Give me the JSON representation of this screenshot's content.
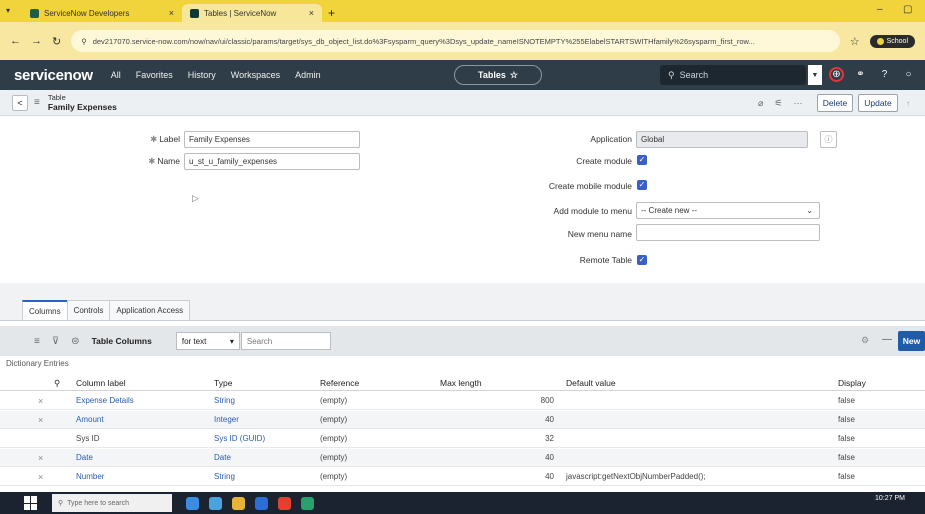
{
  "browser": {
    "tabs": [
      {
        "title": "ServiceNow Developers",
        "active": false
      },
      {
        "title": "Tables | ServiceNow",
        "active": true
      }
    ],
    "url": "dev217070.service-now.com/now/nav/ui/classic/params/target/sys_db_object_list.do%3Fsysparm_query%3Dsys_update_nameISNOTEMPTY%255ElabelSTARTSWITHfamily%26sysparm_first_row...",
    "profile_label": "School"
  },
  "header": {
    "logo": "servicenow",
    "nav": [
      "All",
      "Favorites",
      "History",
      "Workspaces",
      "Admin"
    ],
    "context_pill": "Tables",
    "search_placeholder": "Search"
  },
  "form_header": {
    "record_type": "Table",
    "record_name": "Family Expenses",
    "delete_label": "Delete",
    "update_label": "Update"
  },
  "form": {
    "label_label": "Label",
    "label_value": "Family Expenses",
    "name_label": "Name",
    "name_value": "u_st_u_family_expenses",
    "application_label": "Application",
    "application_value": "Global",
    "create_module_label": "Create module",
    "create_mobile_module_label": "Create mobile module",
    "add_module_label": "Add module to menu",
    "add_module_value": "-- Create new --",
    "new_menu_name_label": "New menu name",
    "new_menu_name_value": "",
    "remote_table_label": "Remote Table",
    "create_module_checked": true,
    "create_mobile_module_checked": true,
    "remote_table_checked": true
  },
  "related_tabs": [
    "Columns",
    "Controls",
    "Application Access"
  ],
  "list": {
    "title": "Table Columns",
    "search_field": "for text",
    "search_placeholder": "Search",
    "new_label": "New",
    "breadcrumb": "Dictionary Entries",
    "columns": [
      "Column label",
      "Type",
      "Reference",
      "Max length",
      "Default value",
      "Display"
    ],
    "rows": [
      {
        "deletable": true,
        "label": "Expense Details",
        "type": "String",
        "reference": "(empty)",
        "max_length": "800",
        "default": "",
        "display": "false"
      },
      {
        "deletable": true,
        "label": "Amount",
        "type": "Integer",
        "reference": "(empty)",
        "max_length": "40",
        "default": "",
        "display": "false"
      },
      {
        "deletable": false,
        "label": "Sys ID",
        "type": "Sys ID (GUID)",
        "reference": "(empty)",
        "max_length": "32",
        "default": "",
        "display": "false"
      },
      {
        "deletable": true,
        "label": "Date",
        "type": "Date",
        "reference": "(empty)",
        "max_length": "40",
        "default": "",
        "display": "false"
      },
      {
        "deletable": true,
        "label": "Number",
        "type": "String",
        "reference": "(empty)",
        "max_length": "40",
        "default": "javascript:getNextObjNumberPadded();",
        "display": "false"
      }
    ]
  },
  "taskbar": {
    "search_placeholder": "Type here to search",
    "time": "10:27 PM"
  },
  "colors": {
    "header_bg": "#2e3d48",
    "browser_bar": "#f1d33c",
    "link": "#2a5db0",
    "new_button": "#1f5ca8",
    "checkbox": "#3b5fc9"
  }
}
